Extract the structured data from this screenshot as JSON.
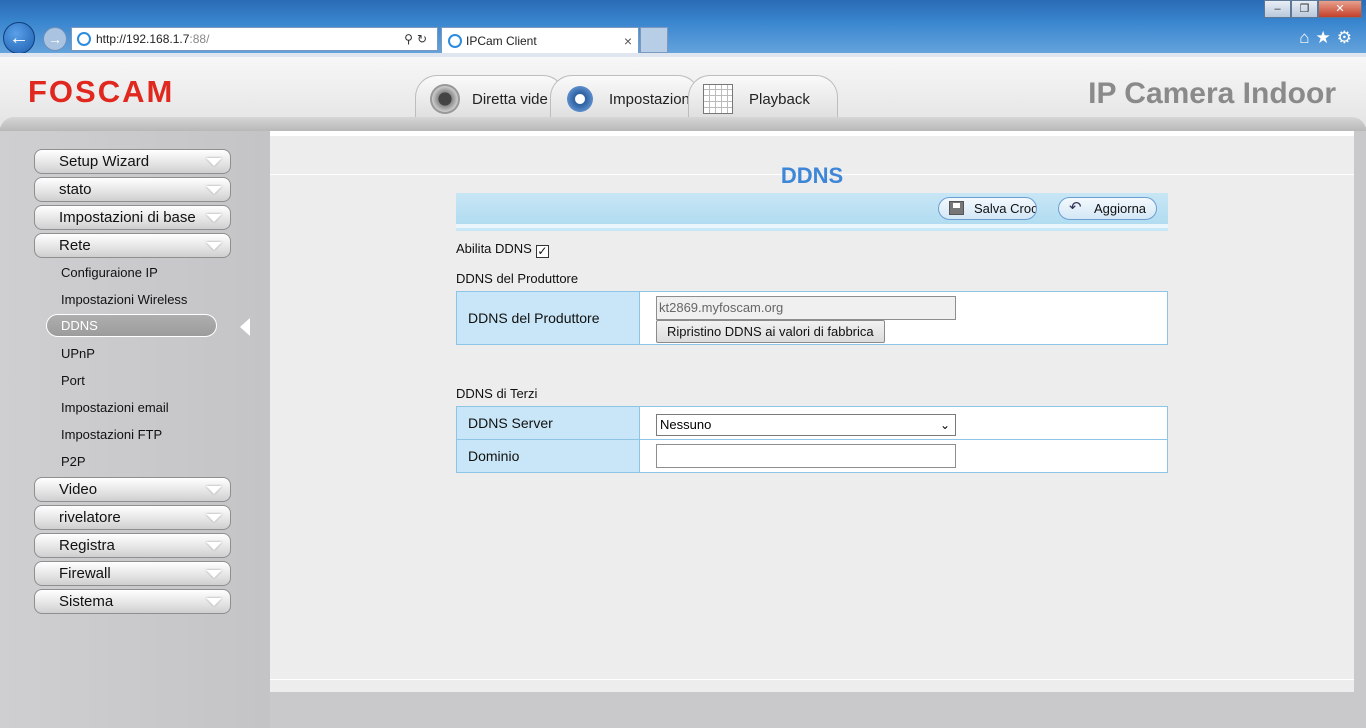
{
  "browser": {
    "address_host": "http://192.168.1.7",
    "address_port": ":88/",
    "tab_title": "IPCam Client",
    "tab_close": "×",
    "back_glyph": "←",
    "forward_glyph": "→",
    "win_minimize": "‒",
    "win_maximize": "❐",
    "win_close": "✕",
    "home_glyph": "⌂",
    "star_glyph": "★",
    "gear_glyph": "⚙",
    "search_glyph": "⚲",
    "refresh_glyph": "↻"
  },
  "header": {
    "logo": "FOSCAM",
    "product": "IP Camera Indoor",
    "tabs": [
      {
        "label": "Diretta video",
        "icon": "webcam-icon"
      },
      {
        "label": "Impostazioni",
        "icon": "gears-icon"
      },
      {
        "label": "Playback",
        "icon": "calendar-icon"
      }
    ]
  },
  "sidebar": {
    "menu": [
      "Setup Wizard",
      "stato",
      "Impostazioni di base",
      "Rete"
    ],
    "submenu": [
      "Configuraione IP",
      "Impostazioni Wireless",
      "DDNS",
      "UPnP",
      "Port",
      "Impostazioni email",
      "Impostazioni FTP",
      "P2P"
    ],
    "active_submenu": "DDNS",
    "menu_bottom": [
      "Video",
      "rivelatore",
      "Registra",
      "Firewall",
      "Sistema"
    ]
  },
  "main": {
    "title": "DDNS",
    "toolbar": {
      "save_label": "Salva Croce",
      "refresh_label": "Aggiorna"
    },
    "enable_label": "Abilita DDNS",
    "enable_checked": "✓",
    "manufacturer_section": "DDNS del Produttore",
    "manufacturer_row_label": "DDNS del Produttore",
    "manufacturer_value": "kt2869.myfoscam.org",
    "reset_button": "Ripristino DDNS ai valori di fabbrica",
    "third_party_section": "DDNS di Terzi",
    "server_label": "DDNS Server",
    "server_value": "Nessuno",
    "domain_label": "Dominio",
    "domain_value": ""
  },
  "colors": {
    "logo_red": "#e0281f",
    "title_blue": "#3d86d8",
    "table_border": "#8ec5e6",
    "label_bg": "#c8e6f7"
  }
}
